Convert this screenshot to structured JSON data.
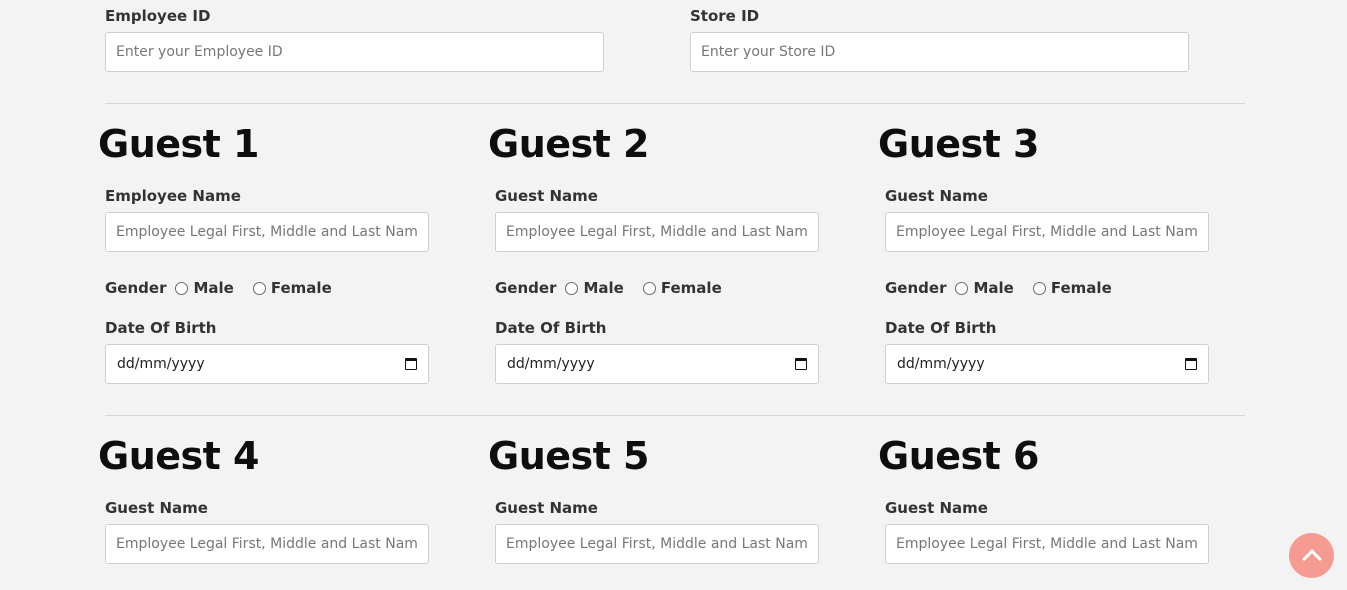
{
  "top": {
    "employee_id": {
      "label": "Employee ID",
      "placeholder": "Enter your Employee ID"
    },
    "store_id": {
      "label": "Store ID",
      "placeholder": "Enter your Store ID"
    }
  },
  "guests": [
    {
      "heading": "Guest 1",
      "name_label": "Employee Name",
      "name_placeholder": "Employee Legal First, Middle and Last Name",
      "gender_label": "Gender",
      "male": "Male",
      "female": "Female",
      "dob_label": "Date Of Birth",
      "dob_value": "dd/mm/yyyy"
    },
    {
      "heading": "Guest 2",
      "name_label": "Guest Name",
      "name_placeholder": "Employee Legal First, Middle and Last Name",
      "gender_label": "Gender",
      "male": "Male",
      "female": "Female",
      "dob_label": "Date Of Birth",
      "dob_value": "dd/mm/yyyy"
    },
    {
      "heading": "Guest 3",
      "name_label": "Guest Name",
      "name_placeholder": "Employee Legal First, Middle and Last Name",
      "gender_label": "Gender",
      "male": "Male",
      "female": "Female",
      "dob_label": "Date Of Birth",
      "dob_value": "dd/mm/yyyy"
    },
    {
      "heading": "Guest 4",
      "name_label": "Guest Name",
      "name_placeholder": "Employee Legal First, Middle and Last Name"
    },
    {
      "heading": "Guest 5",
      "name_label": "Guest Name",
      "name_placeholder": "Employee Legal First, Middle and Last Name"
    },
    {
      "heading": "Guest 6",
      "name_label": "Guest Name",
      "name_placeholder": "Employee Legal First, Middle and Last Name"
    }
  ],
  "colors": {
    "background": "#f3f3f3",
    "scroll_top_button": "#f59b92",
    "heading": "#0e0e0e"
  },
  "icons": {
    "date_picker": "calendar-icon",
    "scroll_top": "chevron-up-icon"
  }
}
